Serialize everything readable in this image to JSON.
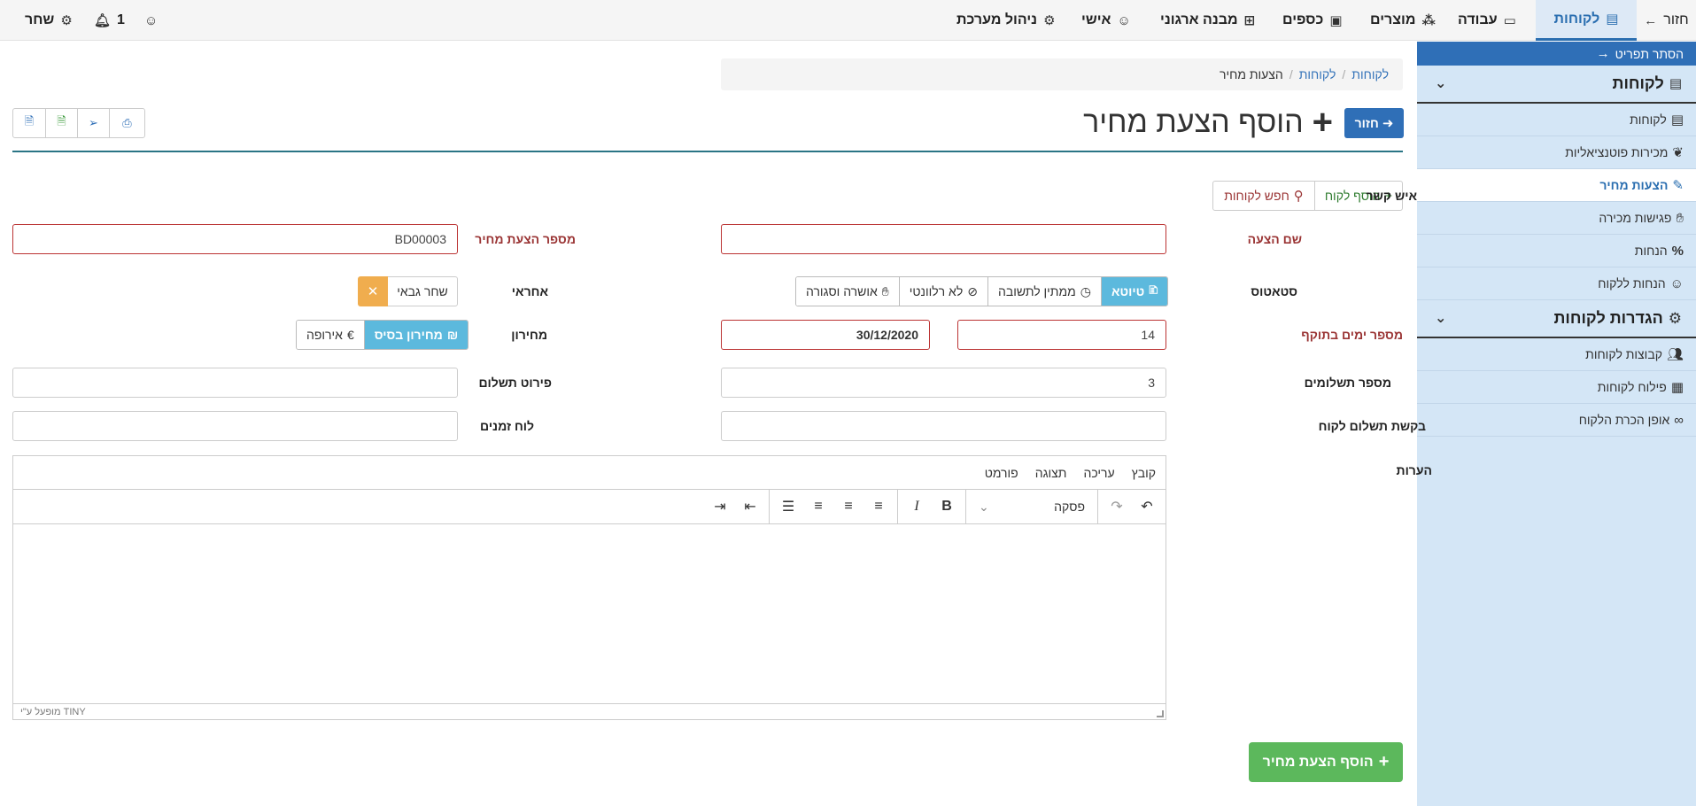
{
  "topnav": {
    "back": "חזור",
    "customers": "לקוחות",
    "work": "עבודה",
    "products": "מוצרים",
    "money": "כספים",
    "org": "מבנה ארגוני",
    "personal": "אישי",
    "admin": "ניהול מערכת",
    "notif_count": "1",
    "user": "שחר"
  },
  "sidebar": {
    "hide_menu": "הסתר תפריט",
    "section1": "לקוחות",
    "items1": [
      "לקוחות",
      "מכירות פוטנציאליות",
      "הצעות מחיר",
      "פגישות מכירה",
      "הנחות",
      "הנחות ללקוח"
    ],
    "section2": "הגדרות לקוחות",
    "items2": [
      "קבוצות לקוחות",
      "פילוח לקוחות",
      "אופן הכרת הלקוח"
    ]
  },
  "breadcrumb": [
    "לקוחות",
    "לקוחות",
    "הצעות מחיר"
  ],
  "page": {
    "back_button": "חזור",
    "title": "הוסף הצעת מחיר"
  },
  "form": {
    "add_customer": "הוסף לקוח",
    "search_customers": "חפש לקוחות",
    "contact_label": "איש קשר",
    "offer_name_label": "שם הצעה",
    "offer_name_value": "",
    "offer_number_label": "מספר הצעת מחיר",
    "offer_number_value": "BD00003",
    "status_label": "סטאטוס",
    "status_options": [
      "טיוטא",
      "ממתין לתשובה",
      "לא רלוונטי",
      "אושרה וסגורה"
    ],
    "responsible_label": "אחראי",
    "responsible_value": "שחר גבאי",
    "validity_days_label": "מספר ימים בתוקף",
    "validity_days_value": "14",
    "validity_date_value": "30/12/2020",
    "pricelist_label": "מחירון",
    "pricelist_options": [
      "מחירון בסיס",
      "אירופה"
    ],
    "payments_label": "מספר תשלומים",
    "payments_value": "3",
    "payment_details_label": "פירוט תשלום",
    "payment_details_value": "",
    "payment_request_label": "בקשת תשלום לקוח",
    "schedule_label": "לוח זמנים",
    "notes_label": "הערות"
  },
  "editor": {
    "menu": [
      "קובץ",
      "עריכה",
      "תצוגה",
      "פורמט"
    ],
    "format_select": "פסקה",
    "footer": "מופעל ע\"י TINY"
  },
  "submit": "הוסף הצעת מחיר"
}
